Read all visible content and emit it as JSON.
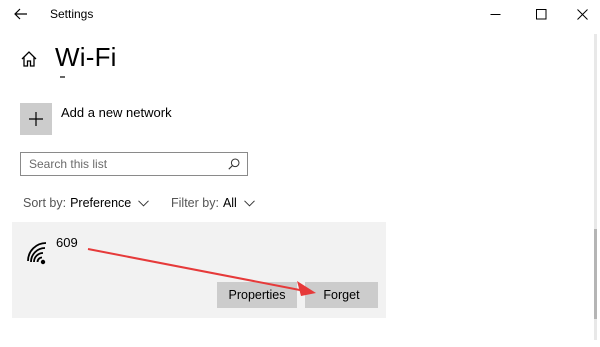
{
  "window": {
    "title": "Settings",
    "controls": {
      "minimize_icon": "minimize-icon",
      "maximize_icon": "maximize-icon",
      "close_icon": "close-icon"
    }
  },
  "header": {
    "back_icon": "back-arrow-icon",
    "home_icon": "home-icon",
    "title": "Wi-Fi"
  },
  "add_network": {
    "icon": "plus-icon",
    "label": "Add a new network"
  },
  "search": {
    "placeholder": "Search this list",
    "value": "",
    "icon": "search-icon"
  },
  "sort": {
    "label": "Sort by:",
    "value": "Preference"
  },
  "filter": {
    "label": "Filter by:",
    "value": "All"
  },
  "networks": [
    {
      "name": "609",
      "icon": "wifi-signal-icon",
      "buttons": {
        "properties": "Properties",
        "forget": "Forget"
      }
    }
  ],
  "colors": {
    "card_background": "#f2f2f2",
    "button_background": "#cccccc",
    "annotation_arrow": "#e63a3a"
  }
}
